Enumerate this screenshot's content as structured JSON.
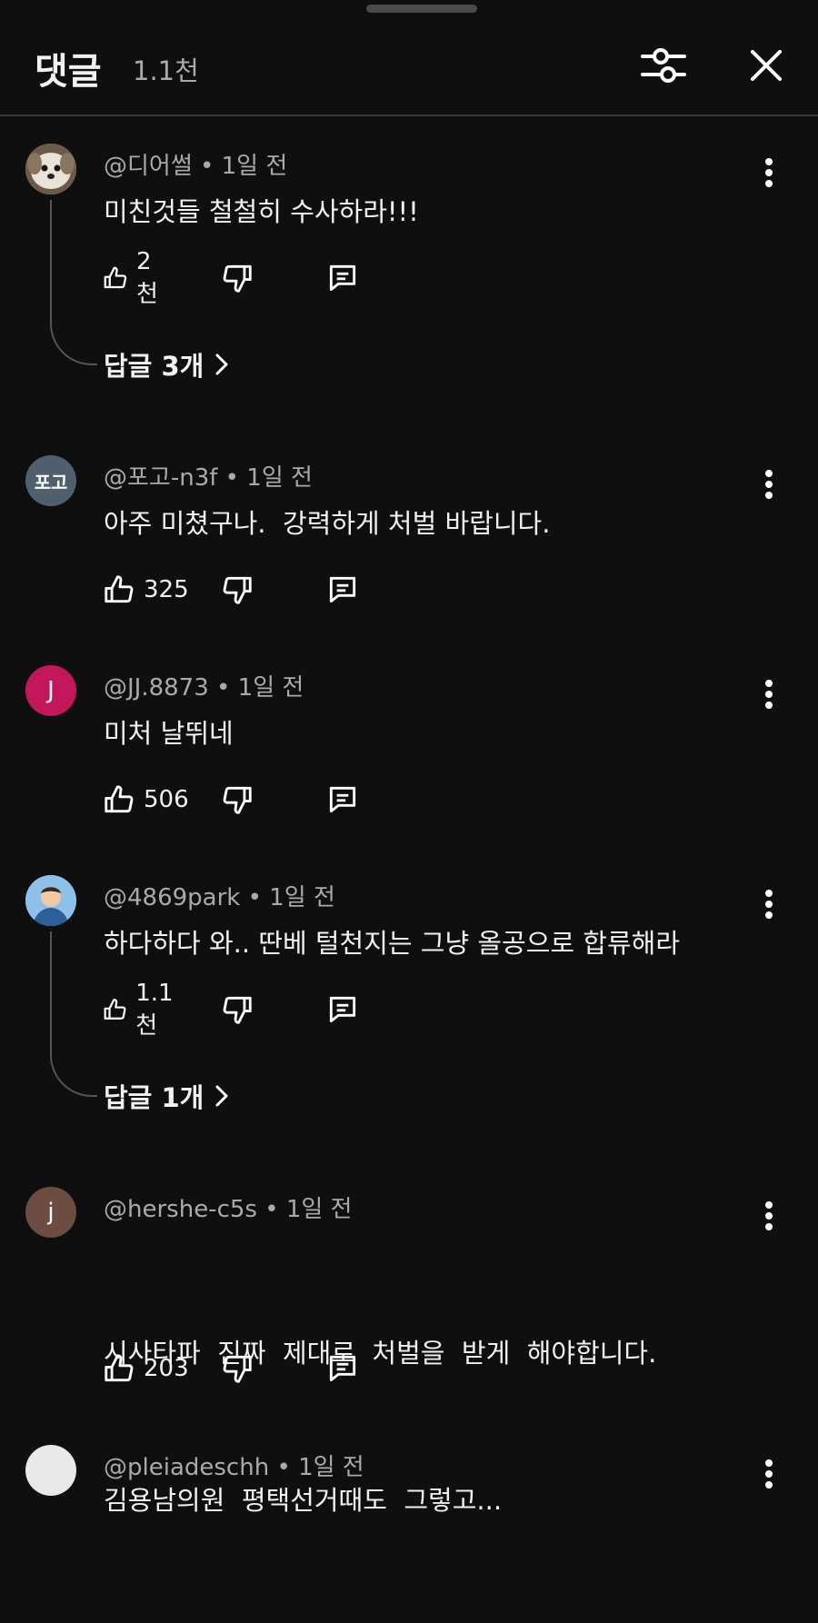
{
  "header": {
    "title": "댓글",
    "count": "1.1천"
  },
  "comments": [
    {
      "author": "@디어썰",
      "time": "1일 전",
      "text": "미친것들 철철히 수사하라!!!",
      "likes": "2천",
      "replies": "답글 3개",
      "avatar_text": "",
      "avatar_color": "#d9d4cc"
    },
    {
      "author": "@포고-n3f",
      "time": "1일 전",
      "text": "아주 미쳤구나.  강력하게 처벌 바랍니다.",
      "likes": "325",
      "avatar_text": "포고",
      "avatar_color": "#4f5f6e"
    },
    {
      "author": "@JJ.8873",
      "time": "1일 전",
      "text": "미처 날뛰네",
      "likes": "506",
      "avatar_text": "J",
      "avatar_color": "#c2185b"
    },
    {
      "author": "@4869park",
      "time": "1일 전",
      "text": "하다하다 와.. 딴베 털천지는 그냥 올공으로 합류해라",
      "likes": "1.1천",
      "replies": "답글 1개",
      "avatar_text": "",
      "avatar_color": "#6fa8dc"
    },
    {
      "author": "@hershe-c5s",
      "time": "1일 전",
      "text_lines": [
        "시사타파  진짜  제대로  처벌을  받게  해야합니다.",
        "김용남의원  평택선거때도  그렇고..."
      ],
      "likes": "203",
      "avatar_text": "j",
      "avatar_color": "#6d4c41"
    },
    {
      "author": "@pleiadeschh",
      "time": "1일 전",
      "avatar_text": "",
      "avatar_color": "#e8e8e8"
    }
  ],
  "icons": {
    "filter": "sliders-icon",
    "close": "close-icon",
    "more": "more-vert-icon",
    "like": "thumb-up-icon",
    "dislike": "thumb-down-icon",
    "reply": "comment-icon"
  }
}
